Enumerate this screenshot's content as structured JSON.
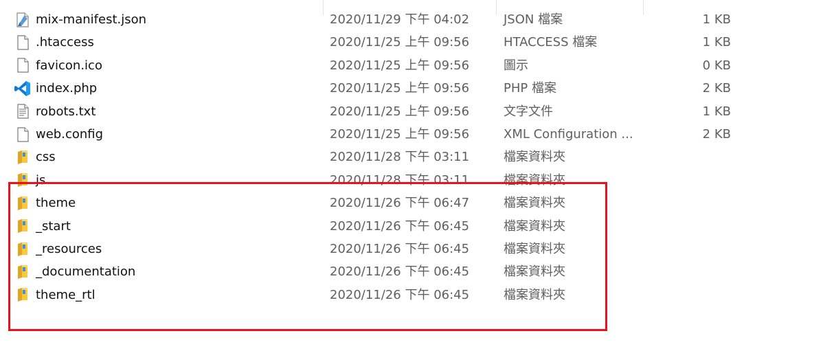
{
  "files": [
    {
      "name": "mix-manifest.json",
      "date": "2020/11/29 下午 04:02",
      "type": "JSON 檔案",
      "size": "1 KB",
      "icon": "json-file-icon"
    },
    {
      "name": ".htaccess",
      "date": "2020/11/25 上午 09:56",
      "type": "HTACCESS 檔案",
      "size": "1 KB",
      "icon": "generic-file-icon"
    },
    {
      "name": "favicon.ico",
      "date": "2020/11/25 上午 09:56",
      "type": "圖示",
      "size": "0 KB",
      "icon": "generic-file-icon"
    },
    {
      "name": "index.php",
      "date": "2020/11/25 上午 09:56",
      "type": "PHP 檔案",
      "size": "2 KB",
      "icon": "vscode-icon"
    },
    {
      "name": "robots.txt",
      "date": "2020/11/25 上午 09:56",
      "type": "文字文件",
      "size": "1 KB",
      "icon": "text-file-icon"
    },
    {
      "name": "web.config",
      "date": "2020/11/25 上午 09:56",
      "type": "XML Configuration ...",
      "size": "2 KB",
      "icon": "generic-file-icon"
    },
    {
      "name": "css",
      "date": "2020/11/28 下午 03:11",
      "type": "檔案資料夾",
      "size": "",
      "icon": "folder-icon"
    },
    {
      "name": "js",
      "date": "2020/11/28 下午 03:11",
      "type": "檔案資料夾",
      "size": "",
      "icon": "folder-icon"
    },
    {
      "name": "theme",
      "date": "2020/11/26 下午 06:47",
      "type": "檔案資料夾",
      "size": "",
      "icon": "folder-icon"
    },
    {
      "name": "_start",
      "date": "2020/11/26 下午 06:45",
      "type": "檔案資料夾",
      "size": "",
      "icon": "folder-icon"
    },
    {
      "name": "_resources",
      "date": "2020/11/26 下午 06:45",
      "type": "檔案資料夾",
      "size": "",
      "icon": "folder-icon"
    },
    {
      "name": "_documentation",
      "date": "2020/11/26 下午 06:45",
      "type": "檔案資料夾",
      "size": "",
      "icon": "folder-icon"
    },
    {
      "name": "theme_rtl",
      "date": "2020/11/26 下午 06:45",
      "type": "檔案資料夾",
      "size": "",
      "icon": "folder-icon"
    }
  ],
  "colors": {
    "highlight_border": "#e8141c",
    "secondary_text": "#5f5f5f",
    "folder_yellow": "#f8c93a",
    "vscode_blue": "#0e7ad3"
  }
}
